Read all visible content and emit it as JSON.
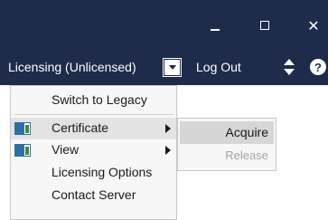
{
  "window": {
    "minimize_icon": "minimize-icon",
    "maximize_icon": "maximize-icon",
    "close_glyph": "✕"
  },
  "toolbar": {
    "licensing_label": "Licensing (Unlicensed)",
    "logout_label": "Log Out",
    "help_glyph": "?"
  },
  "menu": {
    "items": [
      {
        "label": "Switch to Legacy"
      },
      {
        "label": "Certificate",
        "has_submenu": true,
        "highlighted": true
      },
      {
        "label": "View",
        "has_submenu": true
      },
      {
        "label": "Licensing Options"
      },
      {
        "label": "Contact Server"
      }
    ]
  },
  "submenu": {
    "items": [
      {
        "label": "Acquire",
        "enabled": true,
        "highlighted": true
      },
      {
        "label": "Release",
        "enabled": false
      }
    ]
  },
  "colors": {
    "titlebar": "#1e2b4a",
    "menu_bg": "#f7f7f7",
    "highlight": "#e3e3e3",
    "disabled_text": "#a6a6a6",
    "panel_icon_green": "#3a8a3a",
    "panel_icon_blue": "#2f6fa8"
  }
}
